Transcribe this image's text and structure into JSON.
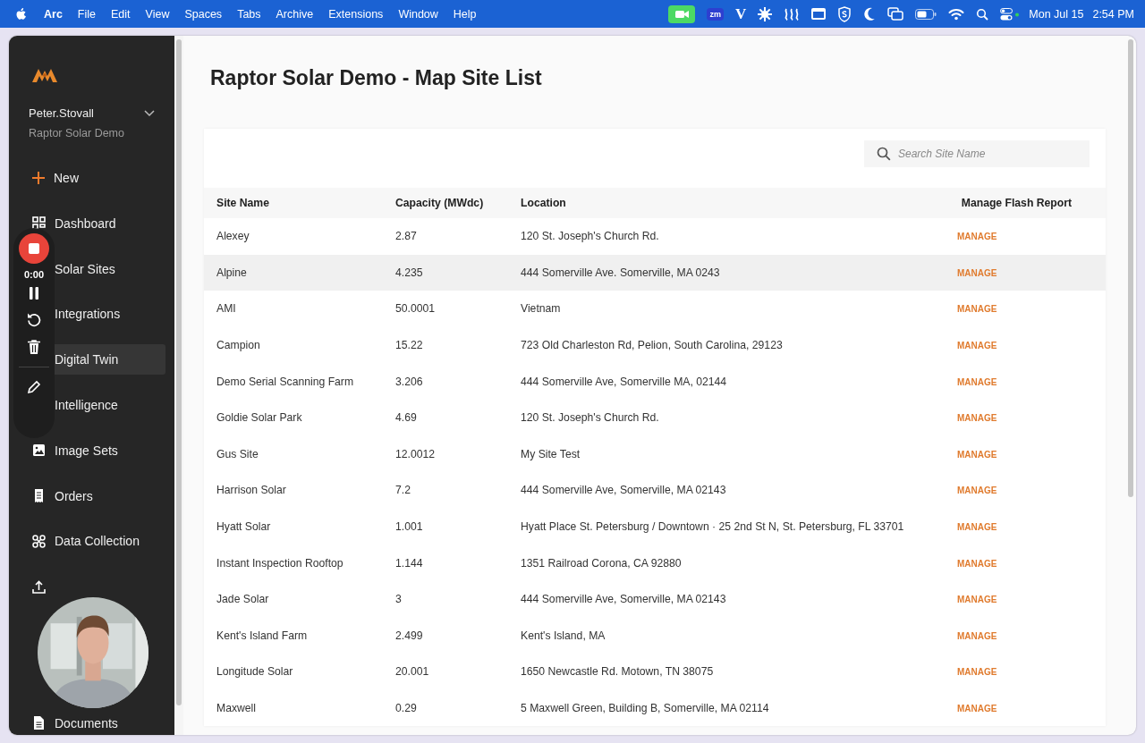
{
  "menu_bar": {
    "app": "Arc",
    "menus": [
      "File",
      "Edit",
      "View",
      "Spaces",
      "Tabs",
      "Archive",
      "Extensions",
      "Window",
      "Help"
    ],
    "status_icons": [
      "zm",
      "V"
    ],
    "date": "Mon Jul 15",
    "time": "2:54 PM"
  },
  "sidebar": {
    "user": {
      "name": "Peter.Stovall",
      "org": "Raptor Solar Demo"
    },
    "new_button": "New",
    "items": [
      {
        "label": "Dashboard",
        "selected": false
      },
      {
        "label": "Solar Sites",
        "selected": false
      },
      {
        "label": "Integrations",
        "selected": false
      },
      {
        "label": "Digital Twin",
        "selected": true
      },
      {
        "label": "Intelligence",
        "selected": false
      },
      {
        "label": "Image Sets",
        "selected": false
      },
      {
        "label": "Orders",
        "selected": false
      },
      {
        "label": "Data Collection",
        "selected": false
      },
      {
        "selected": false
      },
      {
        "label": "Documents",
        "selected": false
      }
    ]
  },
  "recorder": {
    "time": "0:00"
  },
  "page": {
    "title": "Raptor Solar Demo - Map Site List",
    "search": {
      "placeholder": "Search Site Name"
    },
    "table": {
      "columns": [
        "Site Name",
        "Capacity (MWdc)",
        "Location",
        "Manage Flash Report"
      ],
      "rows": [
        {
          "cells": [
            "Alexey",
            "2.87",
            "120 St. Joseph's Church Rd."
          ],
          "action": "MANAGE",
          "hovered": false
        },
        {
          "cells": [
            "Alpine",
            "4.235",
            "444 Somerville Ave. Somerville, MA 0243"
          ],
          "action": "MANAGE",
          "hovered": true
        },
        {
          "cells": [
            "AMI",
            "50.0001",
            "Vietnam"
          ],
          "action": "MANAGE",
          "hovered": false
        },
        {
          "cells": [
            "Campion",
            "15.22",
            "723 Old Charleston Rd, Pelion, South Carolina, 29123"
          ],
          "action": "MANAGE",
          "hovered": false
        },
        {
          "cells": [
            "Demo Serial Scanning Farm",
            "3.206",
            "444 Somerville Ave, Somerville MA, 02144"
          ],
          "action": "MANAGE",
          "hovered": false
        },
        {
          "cells": [
            "Goldie Solar Park",
            "4.69",
            "120 St. Joseph's Church Rd."
          ],
          "action": "MANAGE",
          "hovered": false
        },
        {
          "cells": [
            "Gus Site",
            "12.0012",
            "My Site Test"
          ],
          "action": "MANAGE",
          "hovered": false
        },
        {
          "cells": [
            "Harrison Solar",
            "7.2",
            "444 Somerville Ave, Somerville, MA 02143"
          ],
          "action": "MANAGE",
          "hovered": false
        },
        {
          "cells": [
            "Hyatt Solar",
            "1.001",
            "Hyatt Place St. Petersburg / Downtown · 25 2nd St N, St. Petersburg, FL 33701"
          ],
          "action": "MANAGE",
          "hovered": false
        },
        {
          "cells": [
            "Instant Inspection Rooftop",
            "1.144",
            "1351 Railroad Corona, CA 92880"
          ],
          "action": "MANAGE",
          "hovered": false
        },
        {
          "cells": [
            "Jade Solar",
            "3",
            "444 Somerville Ave, Somerville, MA 02143"
          ],
          "action": "MANAGE",
          "hovered": false
        },
        {
          "cells": [
            "Kent's Island Farm",
            "2.499",
            "Kent's Island, MA"
          ],
          "action": "MANAGE",
          "hovered": false
        },
        {
          "cells": [
            "Longitude Solar",
            "20.001",
            "1650 Newcastle Rd. Motown, TN 38075"
          ],
          "action": "MANAGE",
          "hovered": false
        },
        {
          "cells": [
            "Maxwell",
            "0.29",
            "5 Maxwell Green, Building B, Somerville, MA 02114"
          ],
          "action": "MANAGE",
          "hovered": false
        }
      ]
    }
  }
}
